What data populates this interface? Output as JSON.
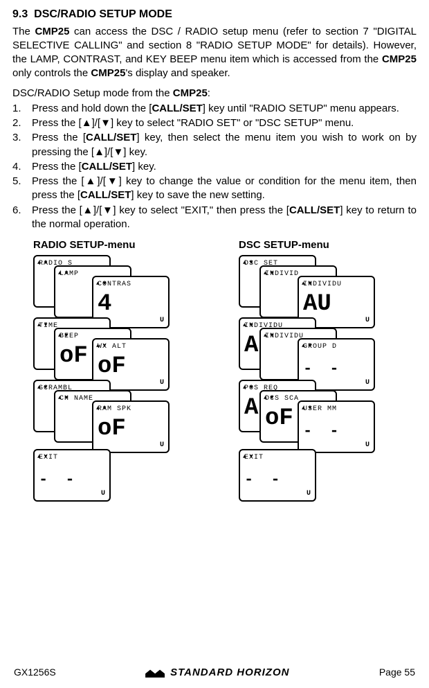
{
  "section": {
    "number": "9.3",
    "title": "DSC/RADIO SETUP MODE"
  },
  "intro": {
    "p1a": "The  ",
    "cmp": "CMP25",
    "p1b": " can access the DSC / RADIO setup menu (refer to section 7 \"DIGITAL SELECTIVE CALLING\" and section 8 \"RADIO SETUP MODE\" for details). However, the LAMP, CONTRAST, and KEY BEEP menu item which is accessed from the ",
    "p1c": " only controls the ",
    "p1d": "'s display and speaker."
  },
  "leadin_a": "DSC/RADIO Setup mode from the ",
  "leadin_b": ":",
  "steps": {
    "s1a": "Press and hold down the [",
    "s1b": "] key until \"RADIO SETUP\" menu appears.",
    "s2a": "Press the [",
    "s2b": "]/[",
    "s2c": "] key to select \"RADIO SET\" or \"DSC SETUP\" menu.",
    "s3a": "Press the [",
    "s3b": "] key, then select the menu item you wish to work on by pressing the [",
    "s3c": "]/[",
    "s3d": "] key.",
    "s4a": "Press the [",
    "s4b": "] key.",
    "s5a": "Press the [",
    "s5b": "]/[",
    "s5c": "] key to change the value or condition for the menu item, then press the [",
    "s5d": "] key to save the new setting.",
    "s6a": "Press the [",
    "s6b": "]/[",
    "s6c": "] key to select \"EXIT,\" then press the [",
    "s6d": "] key to return to the normal operation.",
    "callset": "CALL/SET",
    "up": "▲",
    "down": "▼"
  },
  "menus": {
    "radio_title": "RADIO SETUP-menu",
    "dsc_title": "DSC SETUP-menu"
  },
  "radio_screens": [
    {
      "hdr": "RADIO S",
      "body": "",
      "type": "blank"
    },
    {
      "hdr": "LAMP",
      "body": "",
      "type": "blank"
    },
    {
      "hdr": "CONTRAS",
      "body": "4",
      "type": "big"
    },
    {
      "hdr": "TIME",
      "body": "",
      "type": "blank"
    },
    {
      "hdr": "BEEP",
      "body": "oF",
      "type": "big"
    },
    {
      "hdr": "WX ALT",
      "body": "oF",
      "type": "big"
    },
    {
      "hdr": "SCRAMBL",
      "body": "",
      "type": "blank"
    },
    {
      "hdr": "CH NAME",
      "body": "",
      "type": "blank"
    },
    {
      "hdr": "RAM SPK",
      "body": "oF",
      "type": "big"
    },
    {
      "hdr": "EXIT",
      "body": "- -",
      "type": "dashes"
    }
  ],
  "dsc_screens": [
    {
      "hdr": "DSC SET",
      "body": "",
      "type": "blank"
    },
    {
      "hdr": "INDIVID",
      "body": "",
      "type": "blank"
    },
    {
      "hdr": "INDIVIDU",
      "body": "AU",
      "type": "big"
    },
    {
      "hdr": "INDIVIDU",
      "body": "AL",
      "type": "big"
    },
    {
      "hdr": "INDIVIDU",
      "body": "",
      "type": "blank"
    },
    {
      "hdr": "GROUP D",
      "body": "- -",
      "type": "dashes"
    },
    {
      "hdr": "POS REQ",
      "body": "AL",
      "type": "big"
    },
    {
      "hdr": "DCS SCA",
      "body": "oF",
      "type": "big"
    },
    {
      "hdr": "USER MM",
      "body": "- -",
      "type": "dashes"
    },
    {
      "hdr": "EXIT",
      "body": "- -",
      "type": "dashes"
    }
  ],
  "footer": {
    "model": "GX1256S",
    "brand": "STANDARD HORIZON",
    "page": "Page 55"
  }
}
